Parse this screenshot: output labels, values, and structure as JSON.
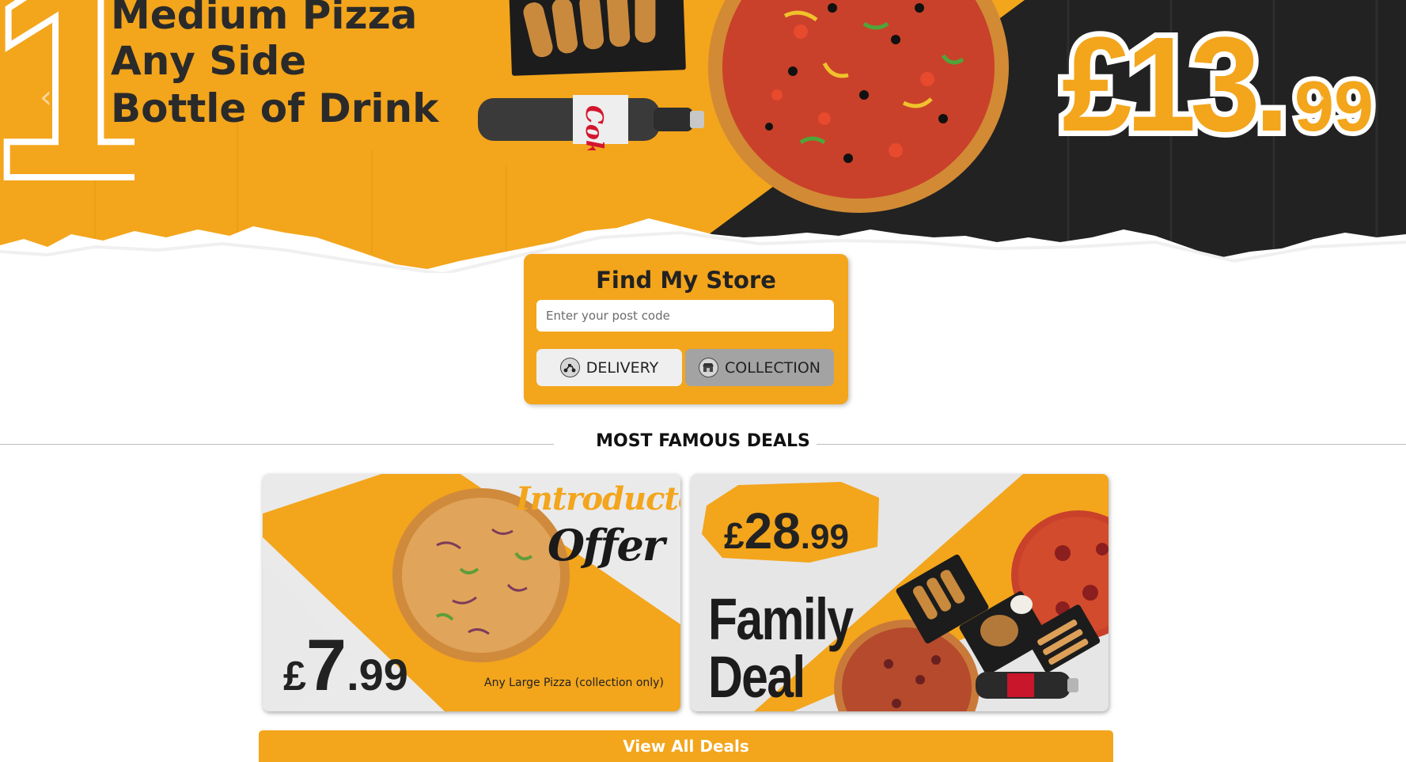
{
  "hero": {
    "big_number": "1",
    "lines": [
      "Medium Pizza",
      "Any Side",
      "Bottle of Drink"
    ],
    "price_main": "£13.",
    "price_pence": "99",
    "drink_label": "Coke",
    "arrow_prev": "‹",
    "arrow_next": "›"
  },
  "find_store": {
    "title": "Find My Store",
    "postcode_placeholder": "Enter your post code",
    "delivery_label": "DELIVERY",
    "collection_label": "COLLECTION"
  },
  "deals": {
    "heading": "MOST FAMOUS DEALS",
    "items": [
      {
        "tagline_1": "Introductory",
        "tagline_2": "Offer",
        "price_symbol": "£",
        "price_main": "7",
        "price_pence": ".99",
        "note": "Any Large Pizza (collection only)"
      },
      {
        "price_symbol": "£",
        "price_main": "28",
        "price_pence": ".99",
        "title_1": "Family",
        "title_2": "Deal"
      }
    ],
    "view_all_label": "View All Deals"
  },
  "colors": {
    "brand_orange": "#f3a51c",
    "dark": "#1f1f1f",
    "delivery_bg": "#efefef",
    "collection_bg": "#a3a3a3"
  },
  "icons": [
    "delivery-scooter-icon",
    "collection-store-icon",
    "chevron-left-icon",
    "chevron-right-icon"
  ]
}
